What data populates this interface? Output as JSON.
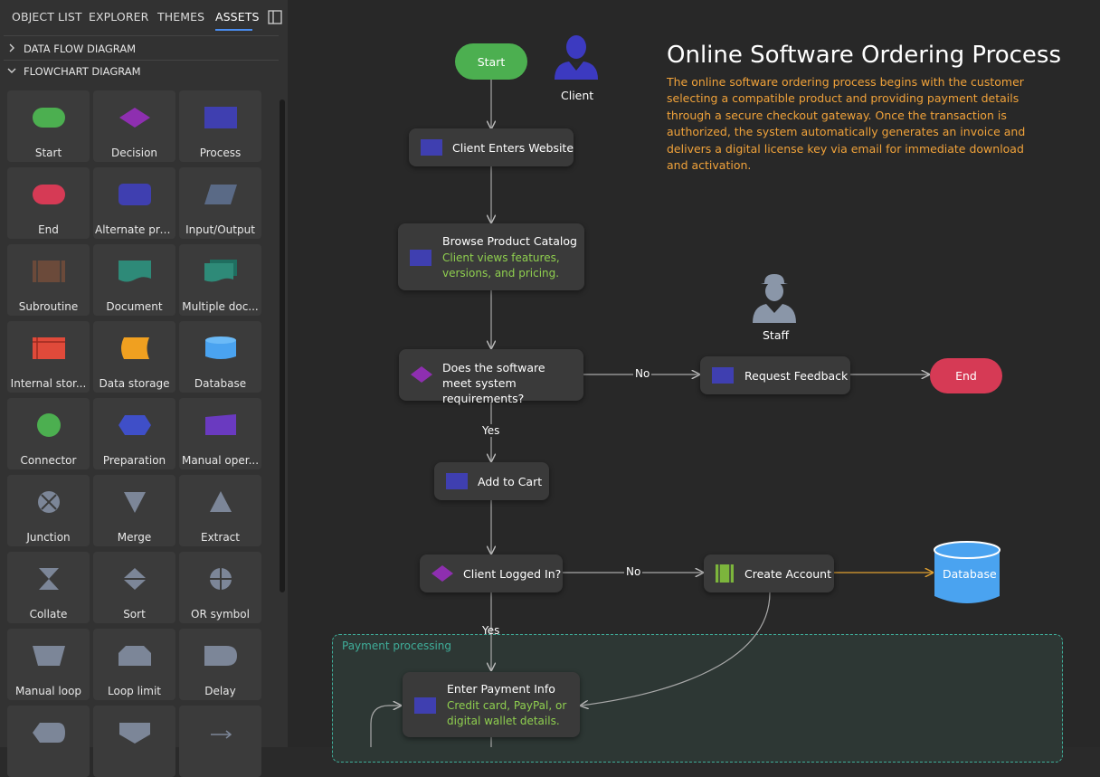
{
  "tabs": [
    {
      "label": "OBJECT LIST"
    },
    {
      "label": "EXPLORER"
    },
    {
      "label": "THEMES"
    },
    {
      "label": "ASSETS",
      "active": true
    }
  ],
  "sections": [
    {
      "label": "DATA FLOW DIAGRAM",
      "expanded": false
    },
    {
      "label": "FLOWCHART DIAGRAM",
      "expanded": true
    }
  ],
  "shapes": [
    {
      "label": "Start",
      "icon": "start-terminator-green"
    },
    {
      "label": "Decision",
      "icon": "decision-diamond-purple"
    },
    {
      "label": "Process",
      "icon": "process-rect-blue"
    },
    {
      "label": "End",
      "icon": "end-terminator-red"
    },
    {
      "label": "Alternate pro...",
      "icon": "alternate-process-blue"
    },
    {
      "label": "Input/Output",
      "icon": "parallelogram-slate"
    },
    {
      "label": "Subroutine",
      "icon": "subroutine-brown"
    },
    {
      "label": "Document",
      "icon": "document-teal"
    },
    {
      "label": "Multiple doc...",
      "icon": "multiple-documents-teal"
    },
    {
      "label": "Internal stor...",
      "icon": "internal-storage-red"
    },
    {
      "label": "Data storage",
      "icon": "data-storage-orange"
    },
    {
      "label": "Database",
      "icon": "database-cylinder-blue"
    },
    {
      "label": "Connector",
      "icon": "connector-circle-green"
    },
    {
      "label": "Preparation",
      "icon": "preparation-hexagon-blue"
    },
    {
      "label": "Manual oper...",
      "icon": "manual-operation-purple"
    },
    {
      "label": "Junction",
      "icon": "junction-circle-x"
    },
    {
      "label": "Merge",
      "icon": "merge-triangle-down"
    },
    {
      "label": "Extract",
      "icon": "extract-triangle-up"
    },
    {
      "label": "Collate",
      "icon": "collate-hourglass"
    },
    {
      "label": "Sort",
      "icon": "sort-diamond"
    },
    {
      "label": "OR symbol",
      "icon": "or-circle-plus"
    },
    {
      "label": "Manual loop",
      "icon": "manual-loop-trapezoid"
    },
    {
      "label": "Loop limit",
      "icon": "loop-limit-shape"
    },
    {
      "label": "Delay",
      "icon": "delay-d-shape"
    },
    {
      "label": "",
      "icon": "display-shape"
    },
    {
      "label": "",
      "icon": "off-page-connector"
    },
    {
      "label": "",
      "icon": "arrow-right"
    }
  ],
  "diagram": {
    "title": "Online Software Ordering Process",
    "description": "The online software ordering process begins with the customer selecting a compatible product and providing payment details through a secure checkout gateway. Once the transaction is authorized, the system automatically generates an invoice and delivers a digital license key via email for immediate download and activation.",
    "actors": {
      "client": "Client",
      "staff": "Staff"
    },
    "start": "Start",
    "end": "End",
    "database": "Database",
    "nodes": {
      "enters_website": "Client Enters Website",
      "browse_catalog": {
        "title": "Browse Product Catalog",
        "subtitle": "Client views features, versions, and pricing."
      },
      "meets_requirements": "Does the software meet system requirements?",
      "request_feedback": "Request Feedback",
      "add_to_cart": "Add to Cart",
      "logged_in": "Client Logged In?",
      "create_account": "Create Account",
      "payment_info": {
        "title": "Enter Payment Info",
        "subtitle": "Credit card, PayPal, or digital wallet details."
      }
    },
    "edge_labels": {
      "no_1": "No",
      "yes_1": "Yes",
      "no_2": "No",
      "yes_2": "Yes"
    },
    "group_label": "Payment processing",
    "colors": {
      "start": "#4caf50",
      "end": "#d63a55",
      "process_icon": "#3f3fb0",
      "decision_icon": "#8e2fb0",
      "subtitle_text": "#8fcf4f",
      "description_text": "#f0a23a",
      "database_fill": "#4aa3f0",
      "accent_tab": "#4a8df0",
      "group_border": "#3fae9a"
    }
  }
}
